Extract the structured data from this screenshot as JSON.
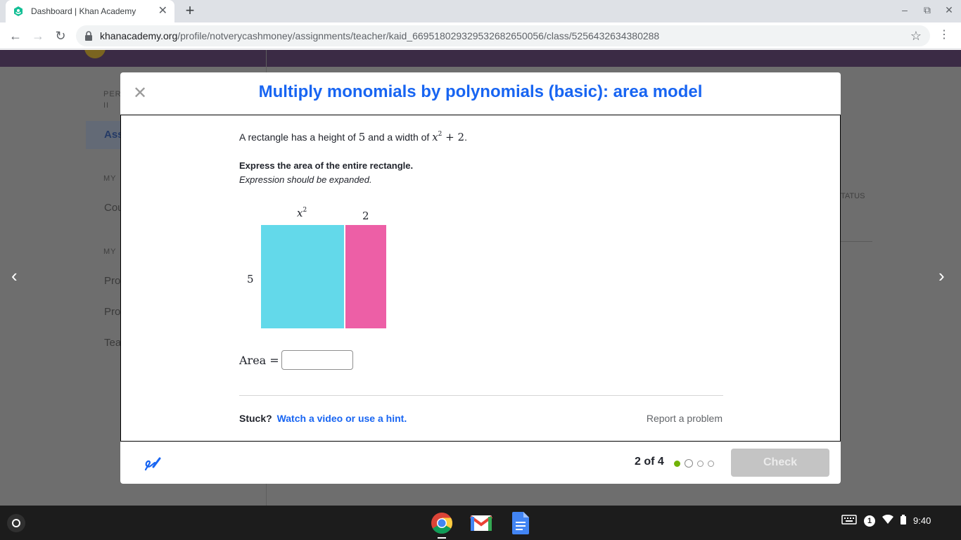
{
  "browser": {
    "tab_title": "Dashboard | Khan Academy",
    "tab_close": "✕",
    "new_tab": "+",
    "url_host": "khanacademy.org",
    "url_path": "/profile/notverycashmoney/assignments/teacher/kaid_669518029329532682650056/class/5256432634380288",
    "back": "←",
    "forward": "→",
    "reload": "↻",
    "bookmark": "☆",
    "menu": "⋮",
    "minimize": "–",
    "restore": "⧉",
    "close": "✕"
  },
  "background_page": {
    "items": [
      "PER",
      "II",
      "Ass",
      "MY",
      "Cou",
      "MY",
      "Pro",
      "Pro",
      "Tea",
      "TATUS"
    ],
    "prev_arrow": "‹",
    "next_arrow": "›"
  },
  "modal": {
    "close": "✕",
    "title": "Multiply monomials by polynomials (basic): area model",
    "problem_prefix": "A rectangle has a height of",
    "height_value": "5",
    "problem_mid": "and a width of",
    "width_var": "x",
    "width_exp": "2",
    "width_rest": "+ 2",
    "problem_end": ".",
    "instruction": "Express the area of the entire rectangle.",
    "instruction_sub": "Expression should be expanded.",
    "diagram": {
      "top_label_left_var": "x",
      "top_label_left_exp": "2",
      "top_label_right": "2",
      "side_label": "5",
      "colors": {
        "left": "#63d9ea",
        "right": "#ed5fa6"
      }
    },
    "area_label": "Area =",
    "area_input_value": "",
    "stuck_label": "Stuck?",
    "hint_link": "Watch a video or use a hint.",
    "report": "Report a problem",
    "progress": "2 of 4",
    "progress_current": 2,
    "progress_total": 4,
    "check_button": "Check"
  },
  "shelf": {
    "notification_count": "1",
    "time": "9:40",
    "apps": [
      "chrome-icon",
      "gmail-icon",
      "docs-icon"
    ]
  },
  "colors": {
    "accent": "#1865f2",
    "progress_done": "#71b307"
  }
}
